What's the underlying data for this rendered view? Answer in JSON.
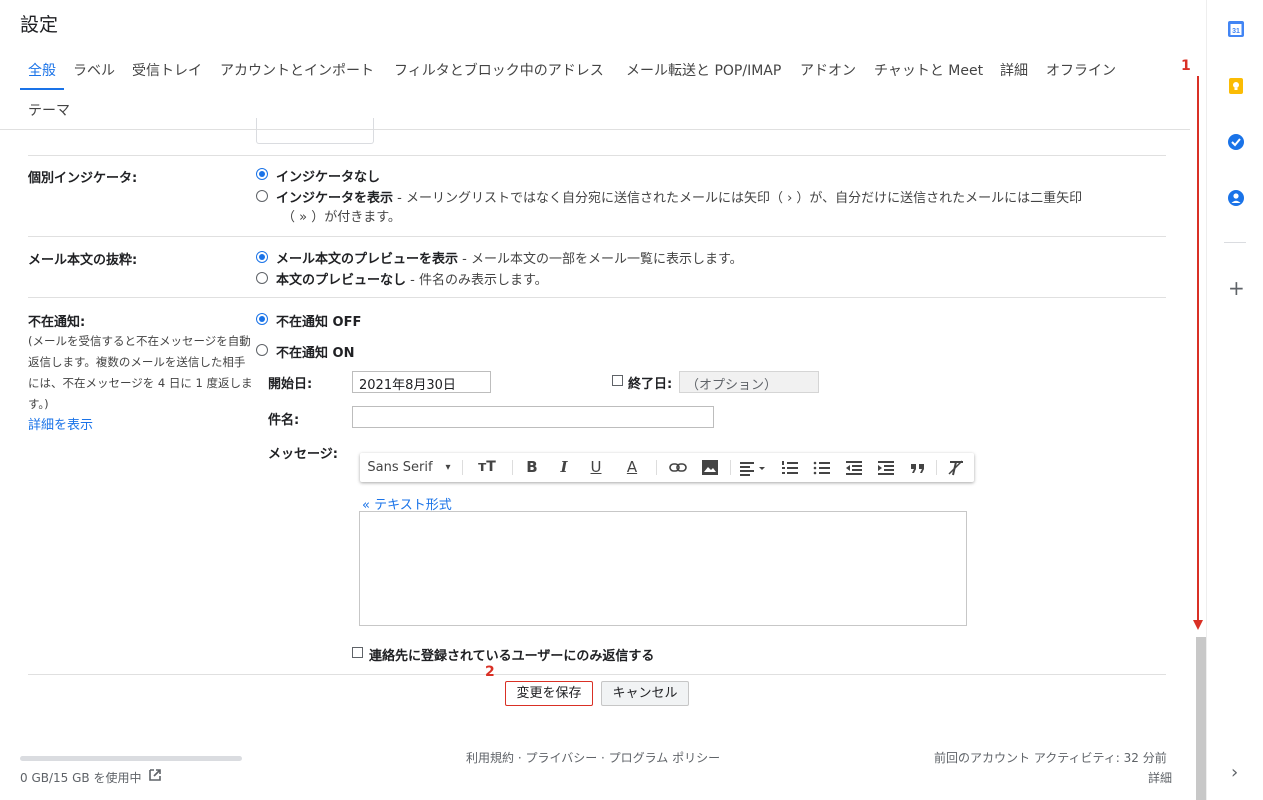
{
  "header": {
    "title": "設定",
    "tabs": [
      "全般",
      "ラベル",
      "受信トレイ",
      "アカウントとインポート",
      "フィルタとブロック中のアドレス",
      "メール転送と POP/IMAP",
      "アドオン",
      "チャットと Meet",
      "詳細",
      "オフライン",
      "テーマ"
    ]
  },
  "indicator": {
    "label": "個別インジケータ:",
    "option1": "インジケータなし",
    "option2_bold": "インジケータを表示",
    "option2_desc": " - メーリングリストではなく自分宛に送信されたメールには矢印（ › ）が、自分だけに送信されたメールには二重矢印",
    "option2_desc2": "（ » ）が付きます。"
  },
  "snippet": {
    "label": "メール本文の抜粋:",
    "option1_bold": "メール本文のプレビューを表示",
    "option1_desc": " - メール本文の一部をメール一覧に表示します。",
    "option2_bold": "本文のプレビューなし",
    "option2_desc": " - 件名のみ表示します。"
  },
  "vacation": {
    "label": "不在通知:",
    "desc": "(メールを受信すると不在メッセージを自動返信します。複数のメールを送信した相手には、不在メッセージを 4 日に 1 度返します。)",
    "more_link": "詳細を表示",
    "off": "不在通知 OFF",
    "on": "不在通知 ON",
    "start_label": "開始日:",
    "start_value": "2021年8月30日",
    "end_label": "終了日:",
    "end_placeholder": "（オプション）",
    "subject_label": "件名:",
    "message_label": "メッセージ:",
    "plain_text_link": "« テキスト形式",
    "contacts_only": "連絡先に登録されているユーザーにのみ返信する"
  },
  "toolbar": {
    "font": "Sans Serif",
    "font_dropdown": "▾",
    "size": "тT",
    "bold": "B",
    "italic": "I",
    "underline": "U",
    "color": "A"
  },
  "actions": {
    "save": "変更を保存",
    "cancel": "キャンセル"
  },
  "annotations": {
    "step1": "1",
    "step2": "2"
  },
  "footer": {
    "storage": "0 GB/15 GB を使用中",
    "links": "利用規約 · プライバシー · プログラム ポリシー",
    "activity": "前回のアカウント アクティビティ: 32 分前",
    "details": "詳細"
  },
  "side_panel": {
    "calendar_day": "31",
    "add": "+",
    "expand": "›"
  }
}
